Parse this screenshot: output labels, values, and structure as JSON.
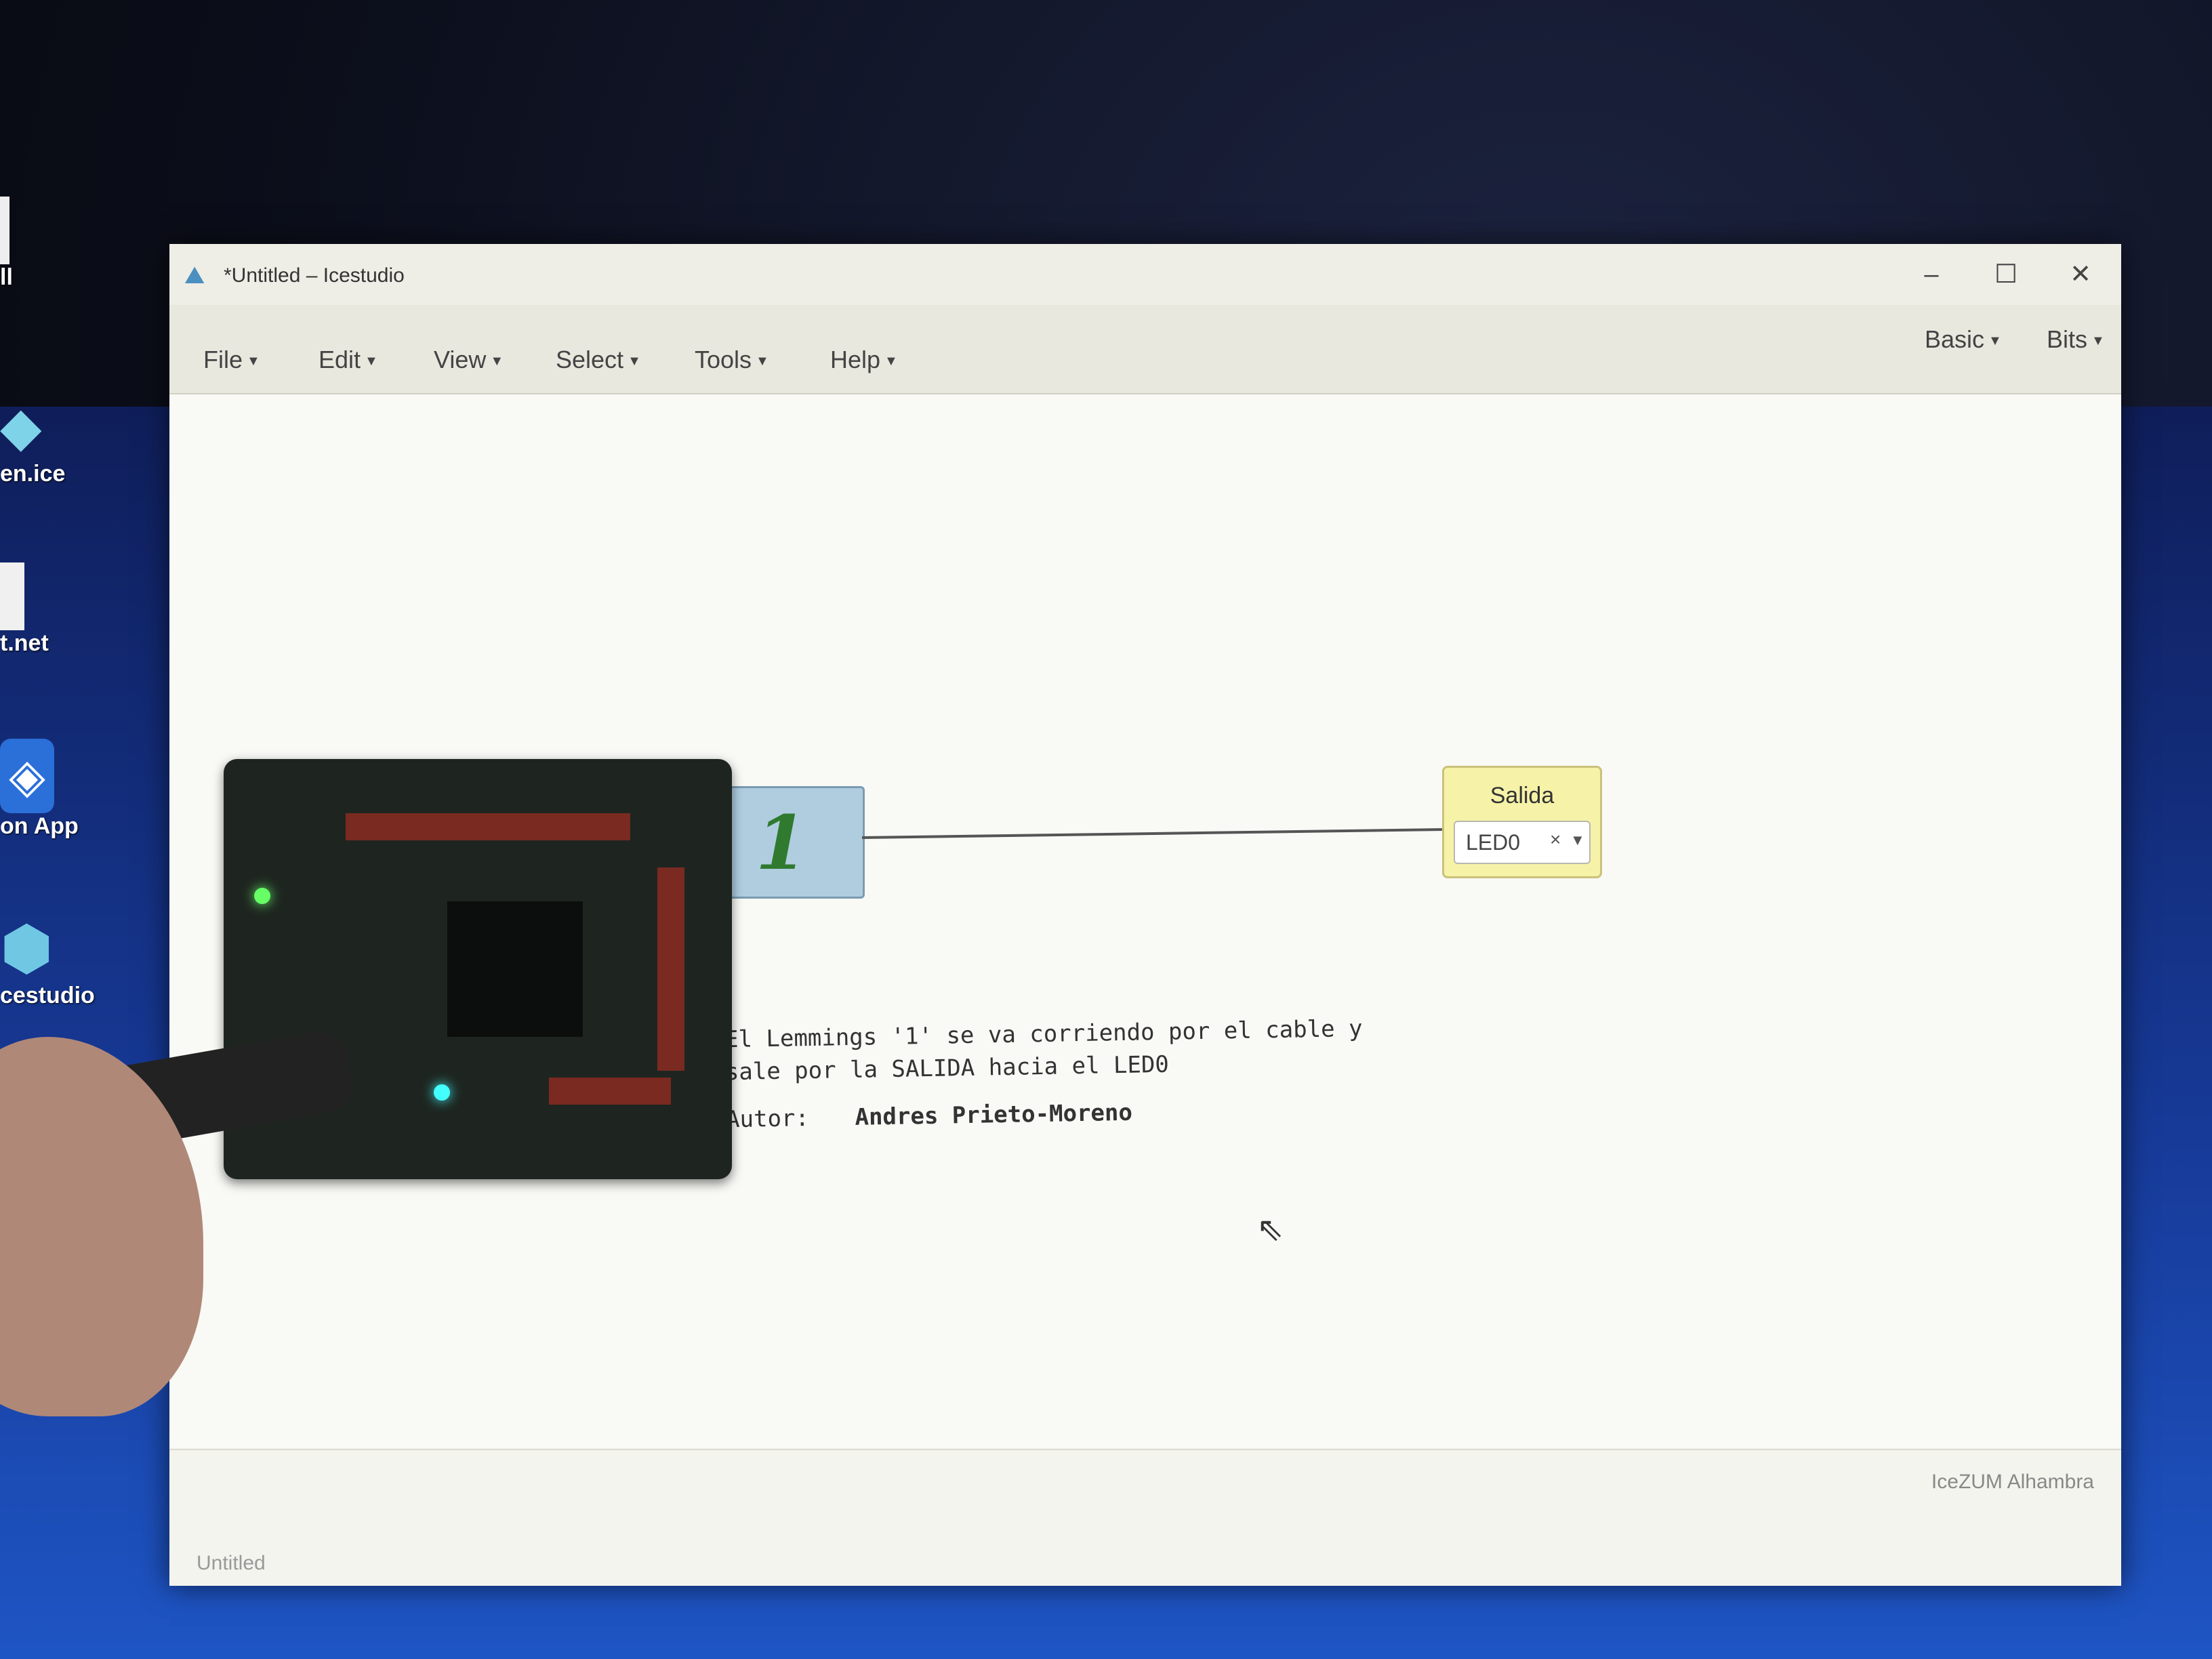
{
  "desktop": {
    "icons": [
      {
        "label": "ll",
        "icon": "doc-icon"
      },
      {
        "label": "en.ice",
        "icon": "icestudio-file-icon"
      },
      {
        "label": "t.net",
        "icon": "paint-net-icon"
      },
      {
        "label": "on App",
        "icon": "app-icon"
      },
      {
        "label": "cestudio",
        "icon": "icestudio-icon"
      }
    ]
  },
  "window": {
    "title": "*Untitled – Icestudio",
    "controls": {
      "minimize": "–",
      "maximize": "☐",
      "close": "✕"
    }
  },
  "menubar": {
    "items": [
      "File",
      "Edit",
      "View",
      "Select",
      "Tools",
      "Help"
    ],
    "right_items": [
      "Basic",
      "Bits"
    ]
  },
  "canvas": {
    "constant_block": {
      "value": "1"
    },
    "output_block": {
      "title": "Salida",
      "pin": "LED0",
      "clear": "×"
    },
    "comment": {
      "line1": "El Lemmings '1' se va corriendo por el cable y",
      "line2": "sale por la SALIDA hacia el LED0",
      "author_label": "Autor:",
      "author": "Andres Prieto-Moreno"
    }
  },
  "statusbar": {
    "board": "IceZUM Alhambra",
    "file": "Untitled"
  }
}
